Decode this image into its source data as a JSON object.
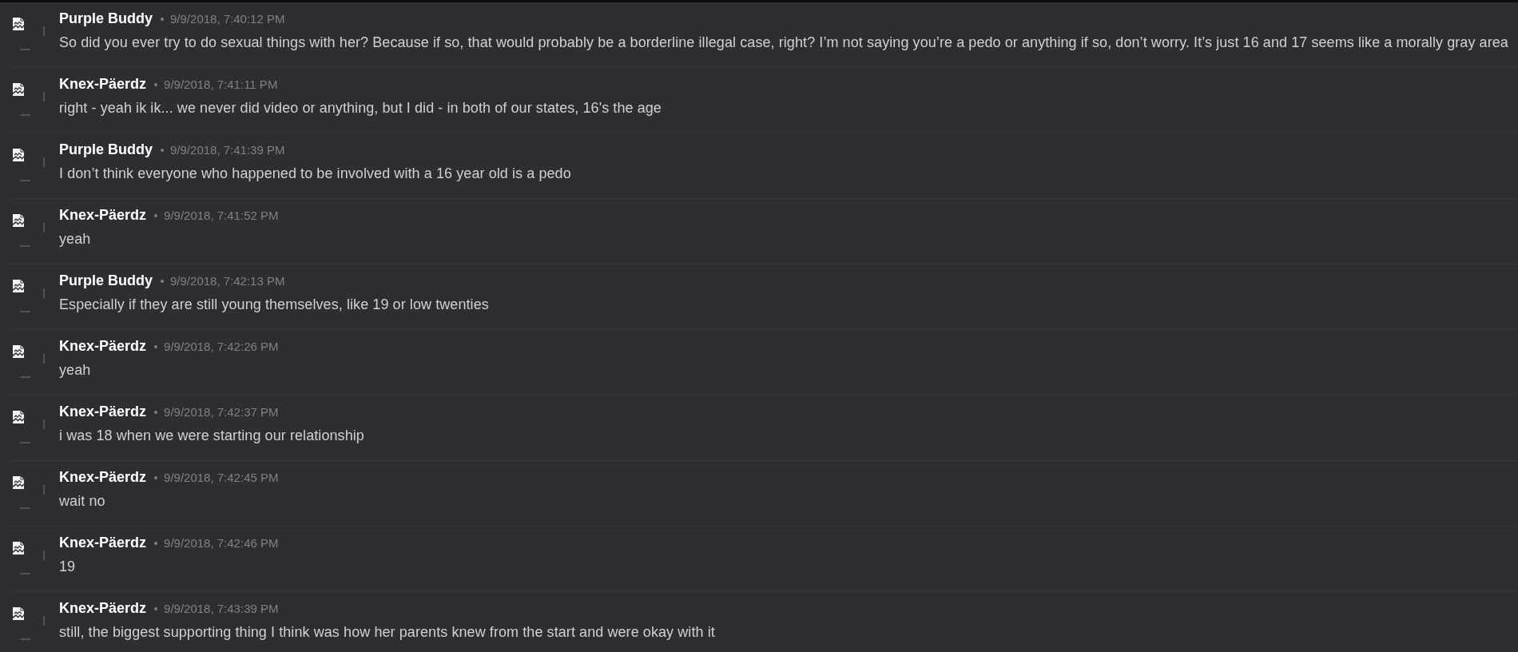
{
  "messages": [
    {
      "author": "Purple Buddy",
      "timestamp": "9/9/2018, 7:40:12 PM",
      "text": "So did you ever try to do sexual things with her? Because if so, that would probably be a borderline illegal case, right? I’m not saying you’re a pedo or anything if so, don’t worry. It’s just 16 and 17 seems like a morally gray area"
    },
    {
      "author": "Knex-Päerdz",
      "timestamp": "9/9/2018, 7:41:11 PM",
      "text": "right - yeah ik ik... we never did video or anything, but I did - in both of our states, 16's the age"
    },
    {
      "author": "Purple Buddy",
      "timestamp": "9/9/2018, 7:41:39 PM",
      "text": "I don’t think everyone who happened to be involved with a 16 year old is a pedo"
    },
    {
      "author": "Knex-Päerdz",
      "timestamp": "9/9/2018, 7:41:52 PM",
      "text": "yeah"
    },
    {
      "author": "Purple Buddy",
      "timestamp": "9/9/2018, 7:42:13 PM",
      "text": "Especially if they are still young themselves, like 19 or low twenties"
    },
    {
      "author": "Knex-Päerdz",
      "timestamp": "9/9/2018, 7:42:26 PM",
      "text": "yeah"
    },
    {
      "author": "Knex-Päerdz",
      "timestamp": "9/9/2018, 7:42:37 PM",
      "text": "i was 18 when we were starting our relationship"
    },
    {
      "author": "Knex-Päerdz",
      "timestamp": "9/9/2018, 7:42:45 PM",
      "text": "wait no"
    },
    {
      "author": "Knex-Päerdz",
      "timestamp": "9/9/2018, 7:42:46 PM",
      "text": "19"
    },
    {
      "author": "Knex-Päerdz",
      "timestamp": "9/9/2018, 7:43:39 PM",
      "text": "still, the biggest supporting thing I think was how her parents knew from the start and were okay with it"
    }
  ]
}
